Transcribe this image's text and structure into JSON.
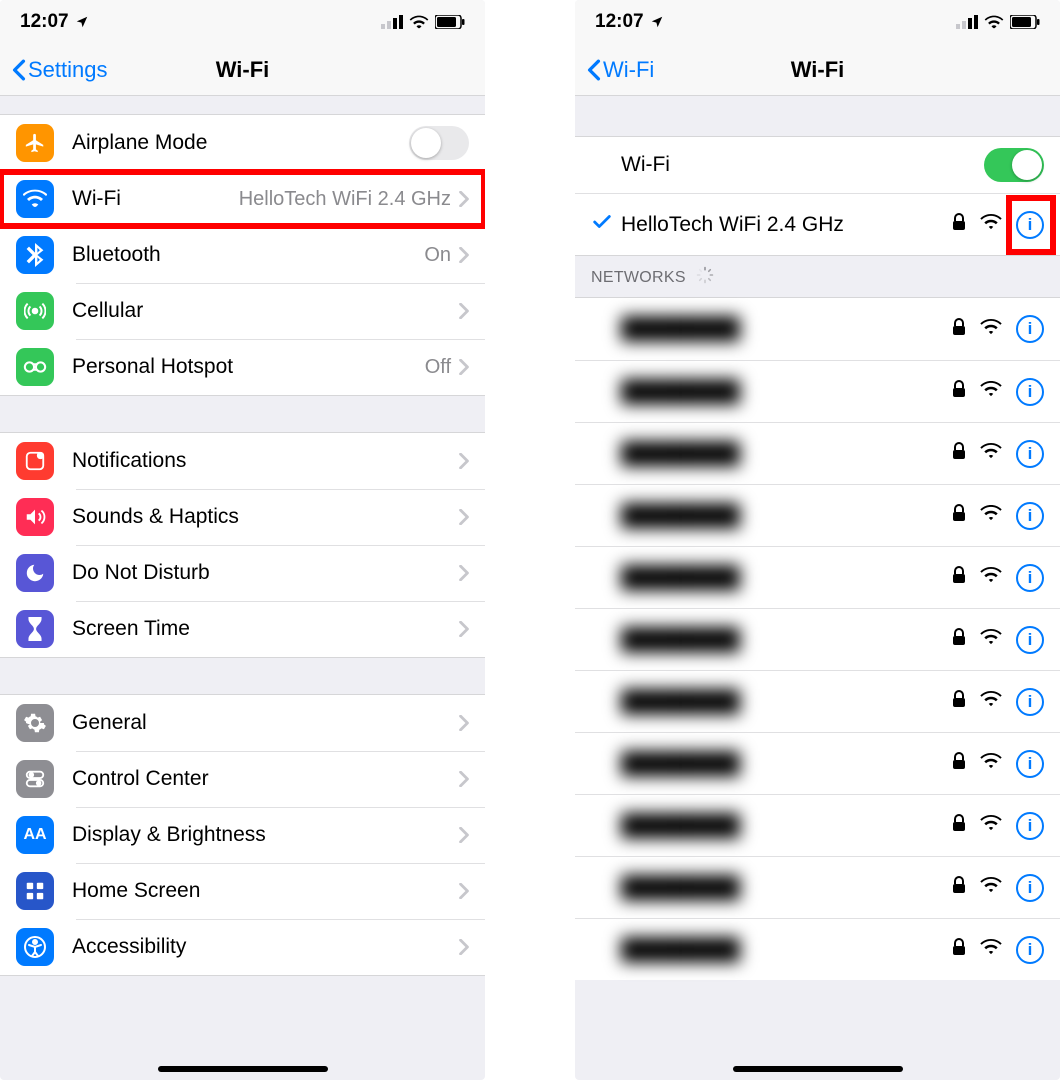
{
  "status": {
    "time": "12:07"
  },
  "left": {
    "back": "Settings",
    "title": "Wi-Fi",
    "g1": {
      "airplane": "Airplane Mode",
      "wifi": "Wi-Fi",
      "wifi_value": "HelloTech WiFi 2.4 GHz",
      "bluetooth": "Bluetooth",
      "bluetooth_value": "On",
      "cellular": "Cellular",
      "hotspot": "Personal Hotspot",
      "hotspot_value": "Off"
    },
    "g2": {
      "notifications": "Notifications",
      "sounds": "Sounds & Haptics",
      "dnd": "Do Not Disturb",
      "screentime": "Screen Time"
    },
    "g3": {
      "general": "General",
      "control": "Control Center",
      "display": "Display & Brightness",
      "home": "Home Screen",
      "accessibility": "Accessibility"
    }
  },
  "right": {
    "back": "Wi-Fi",
    "title": "Wi-Fi",
    "wifi_label": "Wi-Fi",
    "connected": "HelloTech WiFi 2.4 GHz",
    "networks_header": "NETWORKS",
    "other_networks_count": 11
  },
  "colors": {
    "orange": "#ff9500",
    "blue": "#007aff",
    "btblue": "#007aff",
    "green": "#34c759",
    "green2": "#34c759",
    "red": "#ff3b30",
    "purple": "#5856d6",
    "purple2": "#5856d6",
    "gray": "#8e8e93",
    "bluelight": "#007aff",
    "darkblue": "#1d6ff2",
    "homeblue": "#3478f6"
  }
}
